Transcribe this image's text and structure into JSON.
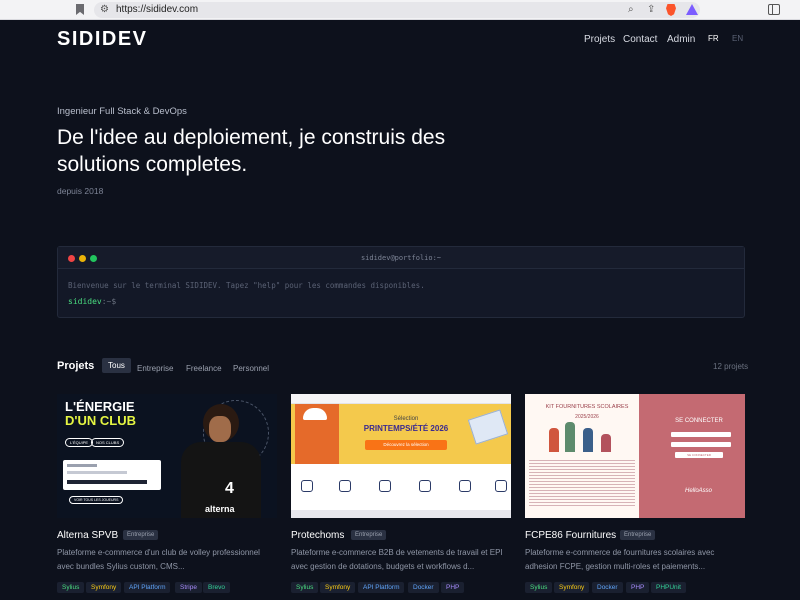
{
  "browser": {
    "url": "https://sididev.com"
  },
  "header": {
    "logo": "SIDIDEV",
    "nav": [
      {
        "label": "Projets"
      },
      {
        "label": "Contact"
      },
      {
        "label": "Admin"
      }
    ],
    "languages": [
      {
        "label": "FR",
        "active": true
      },
      {
        "label": "EN",
        "active": false
      }
    ]
  },
  "hero": {
    "subtitle": "Ingenieur Full Stack & DevOps",
    "title": "De l'idee au deploiement, je construis des solutions completes.",
    "since": "depuis 2018"
  },
  "terminal": {
    "title": "sididev@portfolio:~",
    "welcome": "Bienvenue sur le terminal SIDIDEV. Tapez \"help\" pour les commandes disponibles.",
    "prompt_user": "sididev",
    "prompt_path": ":~$"
  },
  "projects": {
    "heading": "Projets",
    "filters": [
      {
        "label": "Tous",
        "active": true
      },
      {
        "label": "Entreprise",
        "active": false
      },
      {
        "label": "Freelance",
        "active": false
      },
      {
        "label": "Personnel",
        "active": false
      }
    ],
    "count": "12 projets",
    "cards": [
      {
        "title": "Alterna SPVB",
        "badge": "Entreprise",
        "description": "Plateforme e-commerce d'un club de volley professionnel avec bundles Sylius custom, CMS...",
        "tags": [
          {
            "label": "Sylius",
            "color": "#4ade80"
          },
          {
            "label": "Symfony",
            "color": "#facc15"
          },
          {
            "label": "API Platform",
            "color": "#60a5fa"
          },
          {
            "label": "Stripe",
            "color": "#a78bfa"
          },
          {
            "label": "Brevo",
            "color": "#34d399"
          }
        ],
        "image": {
          "headline1": "L'ÉNERGIE",
          "headline2": "D'UN CLUB",
          "pill1": "L'ÉQUIPE",
          "pill2": "NOS CLUBS",
          "cta": "VOIR TOUS LES JOUEURS",
          "jersey_number": "4",
          "jersey_brand": "alterna"
        }
      },
      {
        "title": "Protechoms",
        "badge": "Entreprise",
        "description": "Plateforme e-commerce B2B de vetements de travail et EPI avec gestion de dotations, budgets et workflows d...",
        "tags": [
          {
            "label": "Sylius",
            "color": "#4ade80"
          },
          {
            "label": "Symfony",
            "color": "#facc15"
          },
          {
            "label": "API Platform",
            "color": "#60a5fa"
          },
          {
            "label": "Docker",
            "color": "#60a5fa"
          },
          {
            "label": "PHP",
            "color": "#a78bfa"
          }
        ],
        "image": {
          "selection": "Sélection",
          "season": "PRINTEMPS/ÉTÉ 2026",
          "cta": "Découvrez la sélection"
        }
      },
      {
        "title": "FCPE86 Fournitures",
        "badge": "Entreprise",
        "description": "Plateforme e-commerce de fournitures scolaires avec adhesion FCPE, gestion multi-roles et paiements...",
        "tags": [
          {
            "label": "Sylius",
            "color": "#4ade80"
          },
          {
            "label": "Symfony",
            "color": "#facc15"
          },
          {
            "label": "Docker",
            "color": "#60a5fa"
          },
          {
            "label": "PHP",
            "color": "#a78bfa"
          },
          {
            "label": "PHPUnit",
            "color": "#34d399"
          }
        ],
        "image": {
          "kit": "KIT FOURNITURES SCOLAIRES",
          "year": "2025/2026",
          "connect": "SE CONNECTER",
          "button": "SE CONNECTER",
          "partner": "HelloAsso"
        }
      }
    ]
  },
  "colors": {
    "background": "#0d111c",
    "terminal_bg": "#131827",
    "accent_green": "#4ade80"
  }
}
